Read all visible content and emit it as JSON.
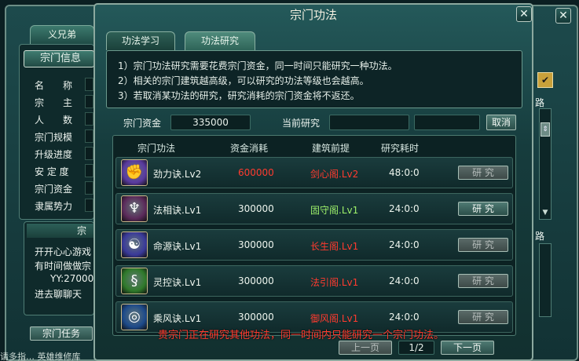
{
  "background": {
    "tabs": [
      "义兄弟"
    ],
    "section_title": "宗门信息",
    "info_labels": [
      "名　　称",
      "宗　　主",
      "人　　数",
      "宗门规模",
      "升级进度",
      "安 定 度",
      "宗门资金",
      "隶属势力"
    ],
    "right_labels": [
      "路",
      "路"
    ],
    "subpanel_title": "宗门",
    "desc_lines": [
      "开开心心游戏",
      "有时间做做宗",
      "YY:27000",
      "进去聊聊天"
    ],
    "bottom_button": "宗门任务",
    "footer_text": "请多指…  英雄维修库"
  },
  "dialog": {
    "title": "宗门功法",
    "close_glyph": "✕",
    "tabs": [
      {
        "label": "功法学习",
        "active": false
      },
      {
        "label": "功法研究",
        "active": true
      }
    ],
    "notice": [
      "1）宗门功法研究需要花费宗门资金，同一时间只能研究一种功法。",
      "2）相关的宗门建筑越高级，可以研究的功法等级也会越高。",
      "3）若取消某功法的研究，研究消耗的宗门资金将不返还。"
    ],
    "funds_label": "宗门资金",
    "funds_value": "335000",
    "current_label": "当前研究",
    "current_value": "",
    "cancel_button": "取消",
    "columns": [
      "宗门功法",
      "资金消耗",
      "建筑前提",
      "研究耗时"
    ],
    "rows": [
      {
        "name": "劲力诀.Lv2",
        "cost": "600000",
        "building": "剑心阁.Lv2",
        "time": "48:0:0",
        "button": "研 究",
        "enabled": false,
        "cost_color": "#ff3b2f",
        "building_color": "#ff3b2f",
        "icon": "fist-icon",
        "icon_bg": "#5a3aa0"
      },
      {
        "name": "法相诀.Lv1",
        "cost": "300000",
        "building": "固守阁.Lv1",
        "time": "24:0:0",
        "button": "研 究",
        "enabled": true,
        "cost_color": "#eef5ee",
        "building_color": "#9df06a",
        "icon": "wings-icon",
        "icon_bg": "#5b2a5a"
      },
      {
        "name": "命源诀.Lv1",
        "cost": "300000",
        "building": "长生阁.Lv1",
        "time": "24:0:0",
        "button": "研 究",
        "enabled": false,
        "cost_color": "#eef5ee",
        "building_color": "#ff3b2f",
        "icon": "meditate-icon",
        "icon_bg": "#3a3a9a"
      },
      {
        "name": "灵控诀.Lv1",
        "cost": "300000",
        "building": "法引阁.Lv1",
        "time": "24:0:0",
        "button": "研 究",
        "enabled": false,
        "cost_color": "#eef5ee",
        "building_color": "#ff3b2f",
        "icon": "dragon-icon",
        "icon_bg": "#2f7a2a"
      },
      {
        "name": "乘风诀.Lv1",
        "cost": "300000",
        "building": "御风阁.Lv1",
        "time": "24:0:0",
        "button": "研 究",
        "enabled": false,
        "cost_color": "#eef5ee",
        "building_color": "#ff3b2f",
        "icon": "wind-icon",
        "icon_bg": "#1d4a8a"
      }
    ],
    "warning": "贵宗门正在研究其他功法，同一时间内只能研究一个宗门功法。",
    "prev_button": "上一页",
    "page_indicator": "1/2",
    "next_button": "下一页"
  }
}
